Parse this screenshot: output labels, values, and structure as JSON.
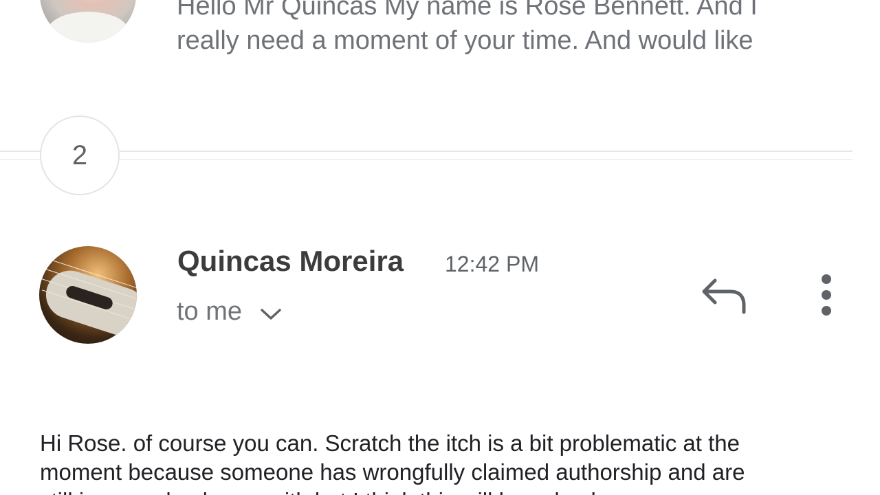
{
  "previous_message": {
    "snippet": "Hello Mr Quincas My name is Rose Bennett. And I\nreally need a moment of your time. And would like"
  },
  "collapsed": {
    "count": "2"
  },
  "message": {
    "sender_name": "Quincas Moreira",
    "time": "12:42 PM",
    "recipient": "to me",
    "body": "Hi Rose. of course you can. Scratch the itch is a bit problematic at the\nmoment because someone has wrongfully claimed authorship and are\nstill in a resolved case with but I think this will be solved soon"
  },
  "icons": {
    "expand": "chevron-down-icon",
    "reply": "reply-icon",
    "more": "more-vert-icon"
  },
  "colors": {
    "icon_gray": "#5f6368",
    "divider": "#e5e6e8",
    "body_text": "#202124"
  }
}
